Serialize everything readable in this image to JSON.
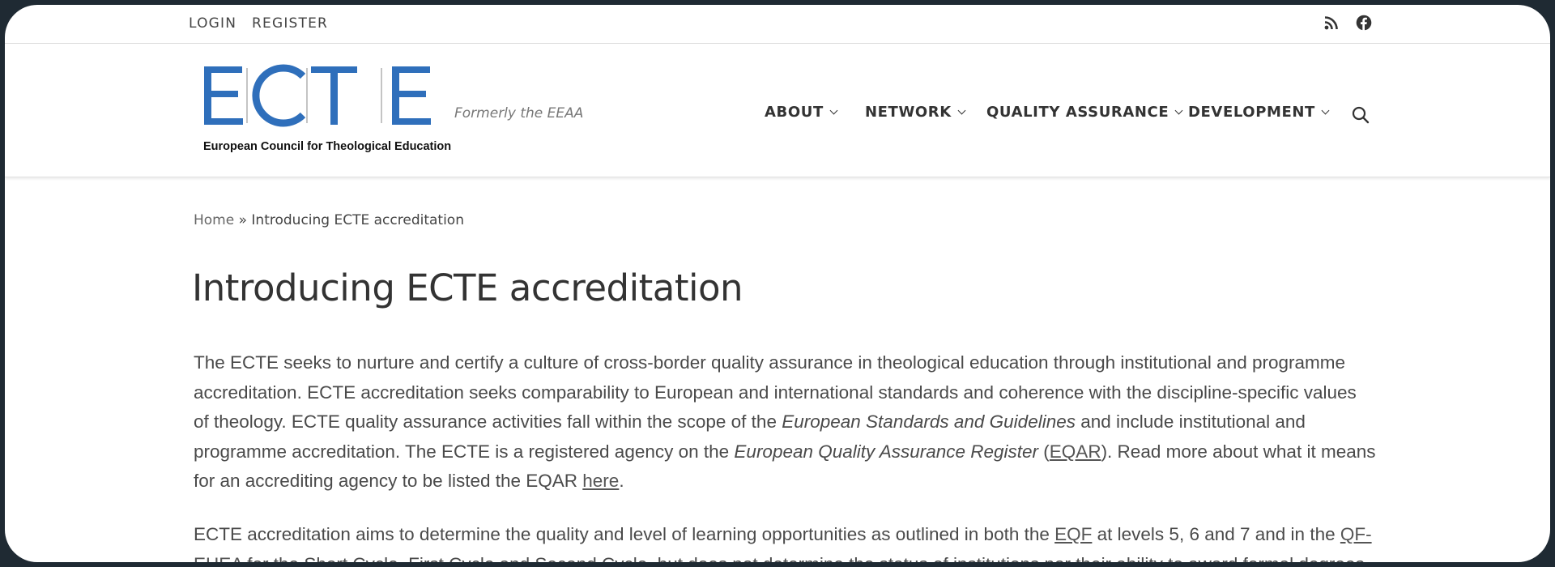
{
  "topbar": {
    "login": "LOGIN",
    "register": "REGISTER",
    "icons": [
      "rss-icon",
      "facebook-icon"
    ]
  },
  "header": {
    "logo_text": "ECTE",
    "logo_subtitle": "European Council for Theological Education",
    "tagline": "Formerly the EEAA",
    "nav": [
      {
        "label": "ABOUT"
      },
      {
        "label": "NETWORK"
      },
      {
        "label": "QUALITY ASSURANCE"
      },
      {
        "label": "DEVELOPMENT"
      }
    ],
    "search_icon": "search-icon",
    "brand_color": "#2f6fbb"
  },
  "breadcrumb": {
    "home": "Home",
    "separator": " » ",
    "current": "Introducing ECTE accreditation"
  },
  "page": {
    "title": "Introducing ECTE accreditation",
    "p1": {
      "a": "The ECTE seeks to nurture and certify a culture of cross-border quality assurance in theological education through institutional and programme accreditation.  ECTE accreditation seeks comparability to European and international standards and coherence with the discipline-specific values of theology.  ECTE quality assurance activities fall within the scope of the ",
      "esg": "European Standards and Guidelines",
      "b": " and include institutional and programme accreditation. The ECTE is a registered agency on the ",
      "eqar_full": "European Quality Assurance Register",
      "c": " (",
      "eqar_link": "EQAR",
      "d": "). Read more about what it means for an accrediting agency to be listed the EQAR ",
      "here_link": "here",
      "e": "."
    },
    "p2": {
      "a": "ECTE accreditation aims to determine the quality and level of learning opportunities as outlined in both the ",
      "eqf_link": "EQF",
      "b": " at levels 5, 6 and 7 and in the ",
      "qf_link": "QF-EHEA",
      "c": " for the Short Cycle, First Cycle and Second Cycle, but does not determine the status of institutions nor their ability to award formal degrees."
    }
  }
}
